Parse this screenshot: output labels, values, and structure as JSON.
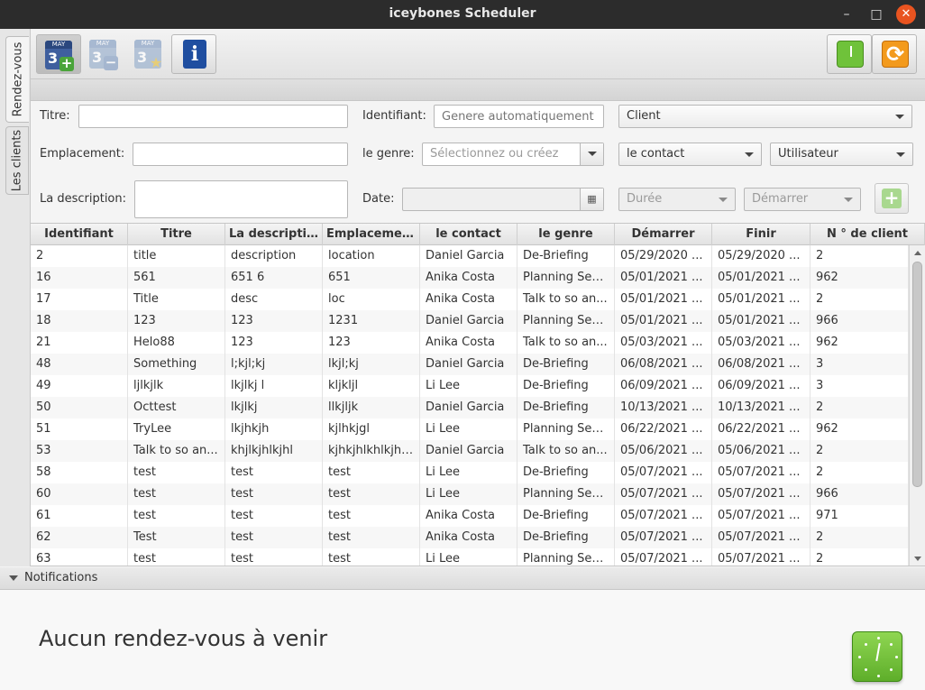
{
  "window": {
    "title": "iceybones Scheduler",
    "minimize": "–",
    "maximize": "□",
    "close": "✕"
  },
  "side_tabs": [
    {
      "label": "Rendez-vous",
      "active": true
    },
    {
      "label": "Les clients",
      "active": false
    }
  ],
  "toolbar": {
    "add_appointment": {
      "icon": "calendar-add-icon",
      "month": "MAY",
      "day": "3"
    },
    "remove_appointment": {
      "icon": "calendar-remove-icon",
      "month": "MAY",
      "day": "3"
    },
    "favorite_appointment": {
      "icon": "calendar-star-icon",
      "month": "MAY",
      "day": "3"
    },
    "info": {
      "icon": "info-icon",
      "glyph": "i"
    },
    "clock": {
      "icon": "clock-icon"
    },
    "refresh": {
      "icon": "refresh-icon",
      "glyph": "⟳"
    }
  },
  "form": {
    "title_label": "Titre:",
    "title_value": "",
    "id_label": "Identifiant:",
    "id_placeholder": "Genere automatiquement",
    "client_label": "Client",
    "location_label": "Emplacement:",
    "location_value": "",
    "type_label": "le genre:",
    "type_placeholder": "Sélectionnez ou créez",
    "contact_label": "le contact",
    "user_label": "Utilisateur",
    "description_label": "La description:",
    "description_value": "",
    "date_label": "Date:",
    "date_button": "▦",
    "duration_label": "Durée",
    "start_label": "Démarrer",
    "add_glyph": "+"
  },
  "table": {
    "columns": [
      "Identifiant",
      "Titre",
      "La description",
      "Emplacement",
      "le contact",
      "le genre",
      "Démarrer",
      "Finir",
      "N ° de client"
    ],
    "rows": [
      [
        "2",
        "title",
        "description",
        "location",
        "Daniel Garcia",
        "De-Briefing",
        "05/29/2020 ...",
        "05/29/2020 ...",
        "2"
      ],
      [
        "16",
        "561",
        "651  6",
        "651",
        "Anika Costa",
        "Planning Ses...",
        "05/01/2021 ...",
        "05/01/2021 ...",
        "962"
      ],
      [
        "17",
        "Title",
        "desc",
        "loc",
        "Anika Costa",
        "Talk to so an...",
        "05/01/2021 ...",
        "05/01/2021 ...",
        "2"
      ],
      [
        "18",
        "123",
        "123",
        "1231",
        "Daniel Garcia",
        "Planning Ses...",
        "05/01/2021 ...",
        "05/01/2021 ...",
        "966"
      ],
      [
        "21",
        "Helo88",
        "123",
        "123",
        "Anika Costa",
        "Talk to so an...",
        "05/03/2021 ...",
        "05/03/2021 ...",
        "962"
      ],
      [
        "48",
        "Something",
        "l;kjl;kj",
        "lkjl;kj",
        "Daniel Garcia",
        "De-Briefing",
        "06/08/2021 ...",
        "06/08/2021 ...",
        "3"
      ],
      [
        "49",
        "ljlkjlk",
        "lkjlkj l",
        "kljkljl",
        "Li Lee",
        "De-Briefing",
        "06/09/2021 ...",
        "06/09/2021 ...",
        "3"
      ],
      [
        "50",
        "Octtest",
        "lkjlkj",
        "llkjljk",
        "Daniel Garcia",
        "De-Briefing",
        "10/13/2021 ...",
        "10/13/2021 ...",
        "2"
      ],
      [
        "51",
        "TryLee",
        "lkjhkjh",
        "kjlhkjgl",
        "Li Lee",
        "Planning Ses...",
        "06/22/2021 ...",
        "06/22/2021 ...",
        "962"
      ],
      [
        "53",
        "Talk to so an...",
        "khjlkjhlkjhl",
        "kjhkjhlkhlkjhj...",
        "Daniel Garcia",
        "Talk to so an...",
        "05/06/2021 ...",
        "05/06/2021 ...",
        "2"
      ],
      [
        "58",
        "test",
        "test",
        "test",
        "Li Lee",
        "De-Briefing",
        "05/07/2021 ...",
        "05/07/2021 ...",
        "2"
      ],
      [
        "60",
        "test",
        "test",
        "test",
        "Li Lee",
        "Planning Ses...",
        "05/07/2021 ...",
        "05/07/2021 ...",
        "966"
      ],
      [
        "61",
        "test",
        "test",
        "test",
        "Anika Costa",
        "De-Briefing",
        "05/07/2021 ...",
        "05/07/2021 ...",
        "971"
      ],
      [
        "62",
        "Test",
        "test",
        "test",
        "Anika Costa",
        "De-Briefing",
        "05/07/2021 ...",
        "05/07/2021 ...",
        "2"
      ],
      [
        "63",
        "test",
        "test",
        "test",
        "Li Lee",
        "Planning Ses...",
        "05/07/2021 ...",
        "05/07/2021 ...",
        "2"
      ]
    ]
  },
  "notifications": {
    "header": "Notifications",
    "message": "Aucun rendez-vous à venir",
    "icon": "clock-icon"
  }
}
